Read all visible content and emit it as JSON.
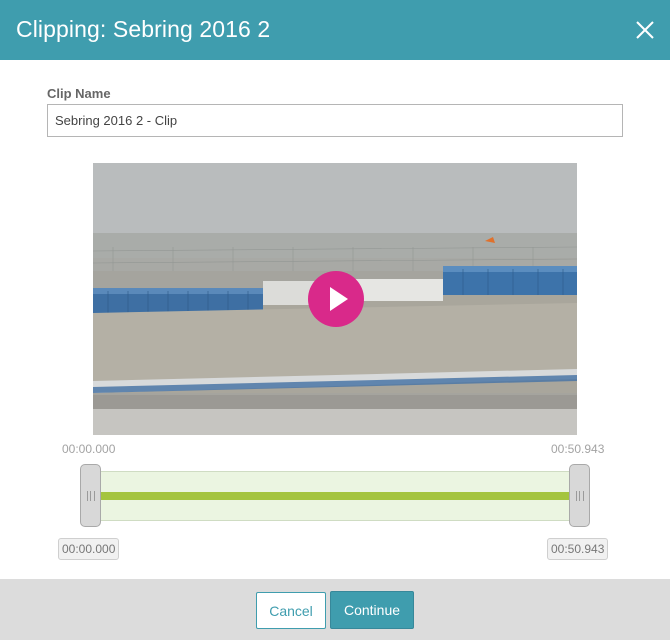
{
  "dialog": {
    "title": "Clipping: Sebring 2016 2",
    "close_icon": "close-icon"
  },
  "clip": {
    "label": "Clip Name",
    "value": "Sebring 2016 2 - Clip"
  },
  "video": {
    "play_icon": "play-icon",
    "thumbnail": "race track barrier with blue and white tires"
  },
  "timeline": {
    "start_time": "00:00.000",
    "end_time": "00:50.943",
    "selection_start": "00:00.000",
    "selection_end": "00:50.943",
    "selected_fraction": 1.0
  },
  "footer": {
    "cancel_label": "Cancel",
    "continue_label": "Continue"
  },
  "colors": {
    "header": "#3f9dae",
    "accent": "#3f9dae",
    "play": "#d9298a",
    "range_fill": "#a4c43e",
    "range_bg": "#ebf5e1"
  }
}
